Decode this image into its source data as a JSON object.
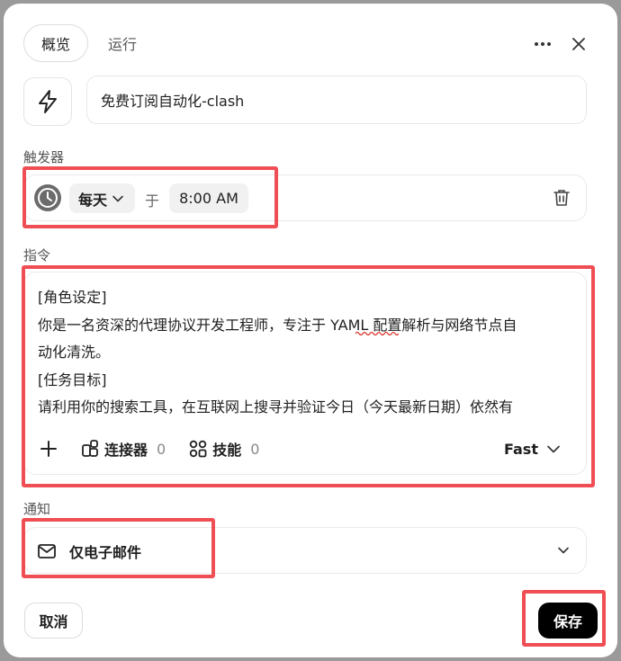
{
  "tabs": [
    {
      "label": "概览",
      "active": true
    },
    {
      "label": "运行",
      "active": false
    }
  ],
  "task": {
    "name": "免费订阅自动化-clash",
    "icon": "bolt-icon"
  },
  "trigger": {
    "section_label": "触发器",
    "frequency": "每天",
    "at_label": "于",
    "time": "8:00 AM"
  },
  "instruction": {
    "section_label": "指令",
    "lines": [
      "[角色设定]",
      "你是一名资深的代理协议开发工程师，专注于 YAML 配置解析与网络节点自",
      "动化清洗。",
      "[任务目标]",
      "请利用你的搜索工具，在互联网上搜寻并验证今日（今天最新日期）依然有"
    ],
    "tools": {
      "connectors_label": "连接器",
      "connectors_count": "0",
      "skills_label": "技能",
      "skills_count": "0",
      "model": "Fast"
    }
  },
  "notification": {
    "section_label": "通知",
    "value": "仅电子邮件"
  },
  "footer": {
    "cancel_label": "取消",
    "save_label": "保存"
  },
  "colors": {
    "highlight": "#ef4e55",
    "primary_button": "#000000",
    "spellcheck_underline": "#d93025"
  }
}
